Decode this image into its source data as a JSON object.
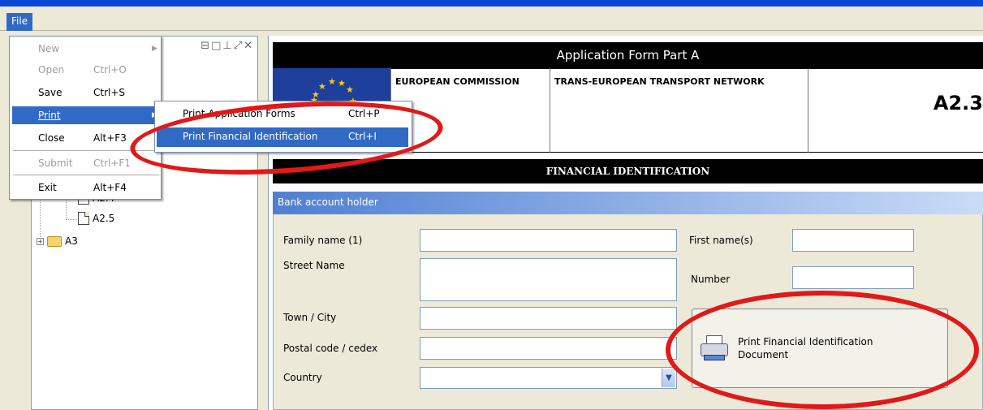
{
  "menubar": {
    "file_label": "File"
  },
  "file_menu": {
    "items": [
      {
        "label": "New",
        "shortcut": ""
      },
      {
        "label": "Open",
        "shortcut": "Ctrl+O"
      },
      {
        "label": "Save",
        "shortcut": "Ctrl+S"
      },
      {
        "label": "Print",
        "shortcut": ""
      },
      {
        "label": "Close",
        "shortcut": "Alt+F3"
      },
      {
        "label": "Submit",
        "shortcut": "Ctrl+F1"
      },
      {
        "label": "Exit",
        "shortcut": "Alt+F4"
      }
    ]
  },
  "print_submenu": {
    "items": [
      {
        "label": "Print Application Forms",
        "shortcut": "Ctrl+P"
      },
      {
        "label": "Print Financial Identification",
        "shortcut": "Ctrl+I"
      }
    ]
  },
  "tree": {
    "toolbar_glyphs": "⊟□⊥⤢✕",
    "nodes": [
      {
        "label": "A2.4"
      },
      {
        "label": "A2.5"
      },
      {
        "label": "A3"
      }
    ]
  },
  "form": {
    "header_title": "Application Form Part A",
    "org1": "EUROPEAN COMMISSION",
    "org2": "TRANS-EUROPEAN TRANSPORT NETWORK",
    "form_code": "A2.3",
    "section_title": "FINANCIAL IDENTIFICATION",
    "group_title": "Bank account holder",
    "labels": {
      "family_name": "Family name (1)",
      "first_names": "First name(s)",
      "street_name": "Street Name",
      "number": "Number",
      "town_city": "Town / City",
      "postal_code": "Postal code / cedex",
      "country": "Country"
    },
    "values": {
      "family_name": "",
      "first_names": "",
      "street_name": "",
      "number": "",
      "town_city": "",
      "postal_code": "",
      "country": ""
    },
    "print_button_label": "Print Financial Identification Document"
  },
  "colors": {
    "menu_highlight": "#316ac5",
    "annotation_red": "#e01919",
    "eu_blue": "#1f3f9d"
  }
}
